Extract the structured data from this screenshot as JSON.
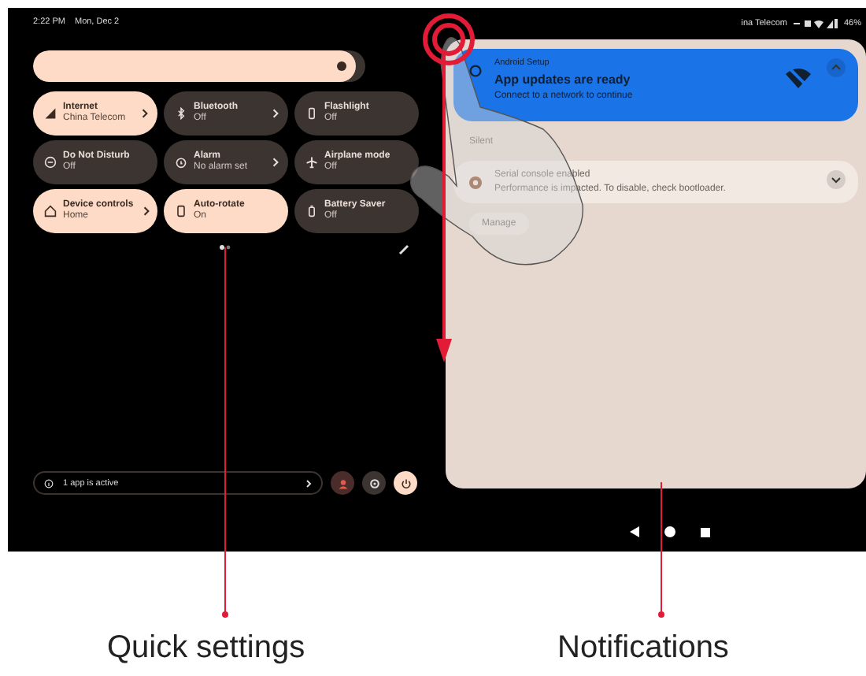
{
  "status_bar": {
    "time": "2:22 PM",
    "date": "Mon, Dec 2",
    "carrier": "ina Telecom",
    "battery": "46%"
  },
  "quick_settings": {
    "brightness": {
      "level": 0.97
    },
    "tiles": [
      {
        "label": "Internet",
        "status": "China Telecom",
        "on": true,
        "chevron": true
      },
      {
        "label": "Bluetooth",
        "status": "Off",
        "on": false,
        "chevron": true
      },
      {
        "label": "Flashlight",
        "status": "Off",
        "on": false,
        "chevron": false
      },
      {
        "label": "Do Not Disturb",
        "status": "Off",
        "on": false,
        "chevron": false
      },
      {
        "label": "Alarm",
        "status": "No alarm set",
        "on": false,
        "chevron": true
      },
      {
        "label": "Airplane mode",
        "status": "Off",
        "on": false,
        "chevron": false
      },
      {
        "label": "Device controls",
        "status": "Home",
        "on": true,
        "chevron": true
      },
      {
        "label": "Auto-rotate",
        "status": "On",
        "on": true,
        "chevron": false
      },
      {
        "label": "Battery Saver",
        "status": "Off",
        "on": false,
        "chevron": false
      }
    ],
    "footer": {
      "active_apps": "1 app is active"
    }
  },
  "notifications": {
    "items": [
      {
        "kind": "alert",
        "app": "Android Setup",
        "title": "App updates are ready",
        "body": "Connect to a network to continue",
        "expanded": true
      },
      {
        "kind": "section",
        "title": "Silent"
      },
      {
        "kind": "silent",
        "title": "Serial console enabled",
        "body": "Performance is impacted. To disable, check bootloader.",
        "expanded": false
      }
    ],
    "manage_button": "Manage"
  },
  "annotations": [
    "Quick settings",
    "Notifications"
  ]
}
